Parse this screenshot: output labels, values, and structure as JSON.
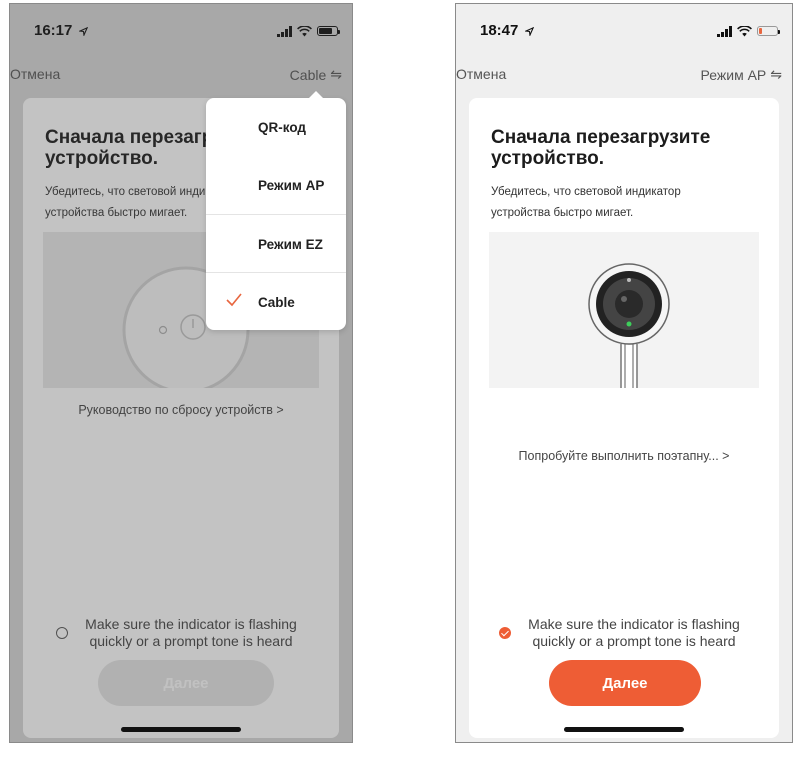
{
  "left_screen": {
    "status": {
      "time": "16:17"
    },
    "nav": {
      "cancel": "Отмена",
      "mode": "Cable",
      "swap_glyph": "⇋"
    },
    "card": {
      "title": "Сначала перезагрузите устройство.",
      "description": "Убедитесь, что световой индикатор устройства быстро мигает.",
      "reset_link": "Руководство по сбросу устройств >",
      "confirm_text": "Make sure the indicator is flashing quickly or a prompt tone is heard",
      "confirm_checked": false,
      "next_button": "Далее"
    },
    "dropdown": {
      "items": [
        {
          "label": "QR-код",
          "selected": false
        },
        {
          "label": "Режим AP",
          "selected": false
        },
        {
          "label": "Режим EZ",
          "selected": false
        },
        {
          "label": "Cable",
          "selected": true
        }
      ]
    }
  },
  "right_screen": {
    "status": {
      "time": "18:47"
    },
    "nav": {
      "cancel": "Отмена",
      "mode": "Режим AP",
      "swap_glyph": "⇋"
    },
    "card": {
      "title": "Сначала перезагрузите устройство.",
      "description": "Убедитесь, что световой индикатор устройства быстро мигает.",
      "step_link": "Попробуйте выполнить поэтапну... >",
      "confirm_text": "Make sure the indicator is flashing quickly or a prompt tone is heard",
      "confirm_checked": true,
      "next_button": "Далее"
    }
  },
  "colors": {
    "accent": "#ee5d35",
    "check": "#e8663f"
  },
  "icons": [
    "location-arrow-icon",
    "signal-icon",
    "wifi-icon",
    "battery-icon",
    "swap-icon",
    "checkmark-icon",
    "camera-icon",
    "reset-button-icon"
  ]
}
